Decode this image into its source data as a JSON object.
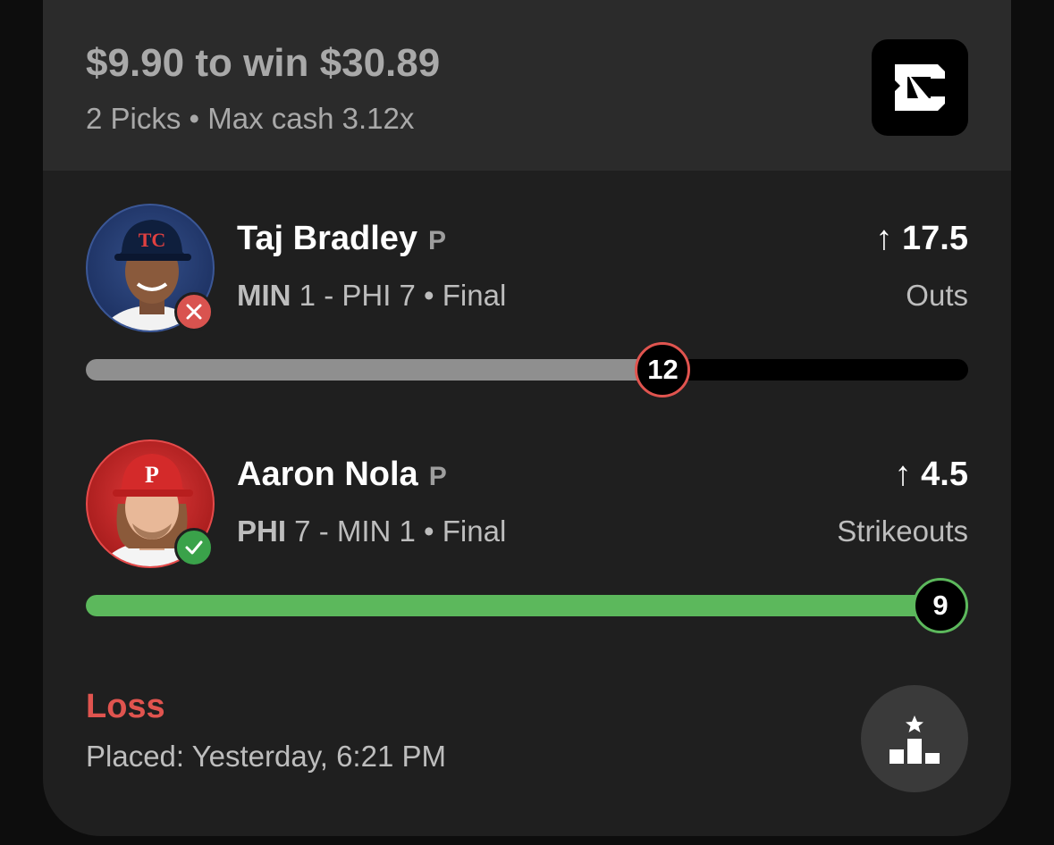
{
  "entry": {
    "title": "$9.90 to win $30.89",
    "subtitle": "2 Picks • Max cash 3.12x",
    "logo_icon": "underdog-logo-icon"
  },
  "picks": [
    {
      "player": "Taj Bradley",
      "position": "P",
      "team": "MIN",
      "game_rest": " 1 - PHI 7 • Final",
      "direction_arrow": "↑",
      "line": "17.5",
      "stat": "Outs",
      "result": "miss",
      "result_icon": "x-icon",
      "current_value": "12",
      "progress_fraction": 0.654,
      "progress_color": "#8f8f8f",
      "avatar_icon": "player-photo-icon"
    },
    {
      "player": "Aaron Nola",
      "position": "P",
      "team": "PHI",
      "game_rest": " 7 - MIN 1 • Final",
      "direction_arrow": "↑",
      "line": "4.5",
      "stat": "Strikeouts",
      "result": "hit",
      "result_icon": "check-icon",
      "current_value": "9",
      "progress_fraction": 1.0,
      "progress_color": "#5cb85c",
      "avatar_icon": "player-photo-icon"
    }
  ],
  "footer": {
    "status": "Loss",
    "placed": "Placed: Yesterday, 6:21 PM",
    "leaderboard_icon": "podium-star-icon"
  },
  "colors": {
    "loss_red": "#e0544f",
    "win_green": "#5cb85c",
    "card_bg": "#1f1f1f",
    "header_bg": "#2b2b2b"
  }
}
